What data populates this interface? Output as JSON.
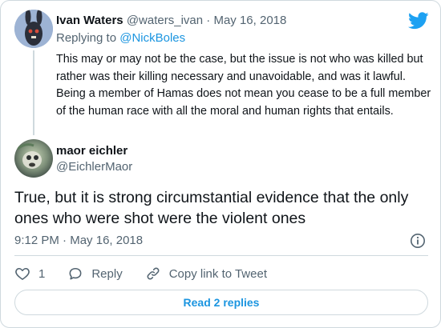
{
  "reply_tweet": {
    "author_name": "Ivan Waters",
    "author_handle": "@waters_ivan",
    "separator": "·",
    "date": "May 16, 2018",
    "replying_label": "Replying to",
    "replying_handle": "@NickBoles",
    "text": "This may or may not be the case, but the issue is not who was killed but rather was their killing necessary and unavoidable, and was it lawful. Being a member of Hamas does not mean you cease to be a full member of the human race with all the moral and human rights that entails."
  },
  "main_tweet": {
    "author_name": "maor eichler",
    "author_handle": "@EichlerMaor",
    "text": "True, but it is strong circumstantial evidence that the only ones who were shot were the violent ones",
    "time": "9:12 PM",
    "separator": "·",
    "date": "May 16, 2018"
  },
  "actions": {
    "like_count": "1",
    "reply_label": "Reply",
    "copy_link_label": "Copy link to Tweet"
  },
  "read_replies_label": "Read 2 replies",
  "icons": {
    "brand": "twitter-bird-icon",
    "info": "info-icon",
    "like": "heart-icon",
    "reply": "speech-bubble-icon",
    "copy_link": "link-icon"
  },
  "colors": {
    "brand_blue": "#1da1f2",
    "link_blue": "#1b95e0",
    "muted_text": "#536471",
    "border": "#cfd9de"
  }
}
